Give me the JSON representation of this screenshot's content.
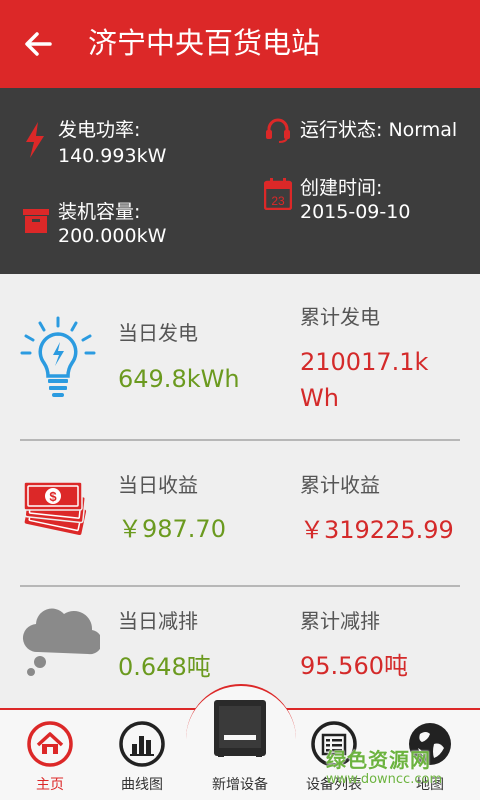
{
  "header": {
    "title": "济宁中央百货电站"
  },
  "info": {
    "power_label": "发电功率:",
    "power_value": "140.993kW",
    "status_label": "运行状态:",
    "status_value": "Normal",
    "capacity_label": "装机容量:",
    "capacity_value": "200.000kW",
    "created_label": "创建时间:",
    "created_value": "2015-09-10",
    "calendar_day": "23"
  },
  "stats": [
    {
      "icon": "lightbulb-icon",
      "left_label": "当日发电",
      "left_value": "649.8kWh",
      "right_label": "累计发电",
      "right_value": "210017.1kWh"
    },
    {
      "icon": "money-stack-icon",
      "left_label": "当日收益",
      "left_value": "￥987.70",
      "right_label": "累计收益",
      "right_value": "￥319225.99"
    },
    {
      "icon": "cloud-icon",
      "left_label": "当日减排",
      "left_value": "0.648吨",
      "right_label": "累计减排",
      "right_value": "95.560吨"
    }
  ],
  "bottom_nav": {
    "items": [
      {
        "label": "主页",
        "icon": "home-icon",
        "active": true
      },
      {
        "label": "曲线图",
        "icon": "bar-chart-icon",
        "active": false
      },
      {
        "label": "新增设备",
        "icon": "device-icon",
        "active": false
      },
      {
        "label": "设备列表",
        "icon": "list-icon",
        "active": false
      },
      {
        "label": "地图",
        "icon": "globe-icon",
        "active": false
      }
    ]
  },
  "watermark": {
    "main": "绿色资源网",
    "sub": "www.downcc.com"
  },
  "colors": {
    "brand_red": "#dc2828",
    "panel_dark": "#3d3d3d",
    "value_green": "#6b9a1f",
    "value_red": "#d42a2a",
    "icon_blue": "#2b9be0"
  }
}
